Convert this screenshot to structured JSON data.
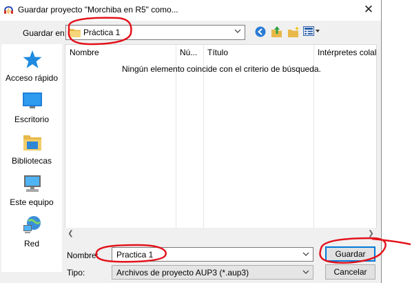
{
  "window": {
    "title": "Guardar proyecto \"Morchiba en R5\" como...",
    "close_symbol": "✕",
    "app_icon": "audacity-icon"
  },
  "location": {
    "label": "Guardar en:",
    "value": "Práctica 1",
    "icon": "folder-icon"
  },
  "toolbar": {
    "buttons": [
      "back-icon",
      "up-folder-icon",
      "new-folder-icon",
      "view-menu-icon"
    ]
  },
  "places": [
    {
      "label": "Acceso rápido",
      "icon": "star-icon"
    },
    {
      "label": "Escritorio",
      "icon": "desktop-icon"
    },
    {
      "label": "Bibliotecas",
      "icon": "libraries-icon"
    },
    {
      "label": "Este equipo",
      "icon": "computer-icon"
    },
    {
      "label": "Red",
      "icon": "network-icon"
    }
  ],
  "list": {
    "columns": [
      "Nombre",
      "Nú...",
      "Título",
      "Intérpretes colal"
    ],
    "empty_message": "Ningún elemento coincide con el criterio de búsqueda."
  },
  "filename": {
    "label": "Nombre:",
    "value": "Practica 1"
  },
  "filetype": {
    "label": "Tipo:",
    "value": "Archivos de proyecto AUP3 (*.aup3)"
  },
  "buttons": {
    "save": "Guardar",
    "cancel": "Cancelar"
  },
  "colors": {
    "annotation": "#e3121b",
    "dialog_bg": "#f0f0f0",
    "accent": "#0078d7"
  }
}
